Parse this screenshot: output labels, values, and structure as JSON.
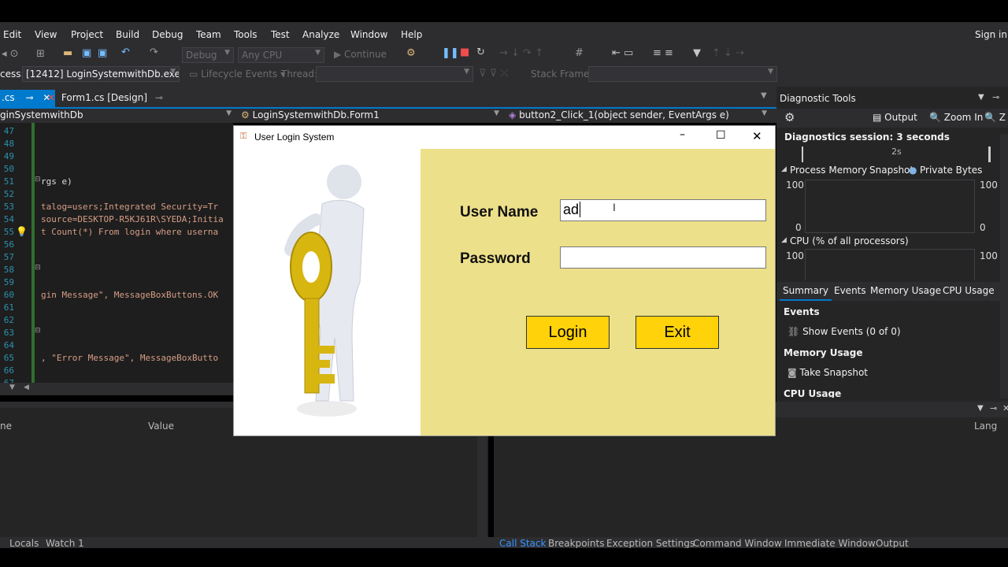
{
  "menu": {
    "items": [
      "Edit",
      "View",
      "Project",
      "Build",
      "Debug",
      "Team",
      "Tools",
      "Test",
      "Analyze",
      "Window",
      "Help"
    ],
    "sign_in": "Sign in"
  },
  "toolbar": {
    "config": "Debug",
    "platform": "Any CPU",
    "continue": "Continue",
    "process_label": "cess:",
    "process_value": "[12412] LoginSystemwithDb.exe",
    "lifecycle": "Lifecycle Events",
    "thread_label": "Thread:",
    "stack_label": "Stack Frame:"
  },
  "tabs": [
    {
      "label": ".cs",
      "pin": "⊸"
    },
    {
      "label": "Form1.cs [Design]",
      "pin": "⊸"
    }
  ],
  "nav": {
    "project": "ginSystemwithDb",
    "class": "LoginSystemwithDb.Form1",
    "method": "button2_Click_1(object sender, EventArgs e)"
  },
  "editor": {
    "lines": [
      "47",
      "48",
      "49",
      "50",
      "51",
      "52",
      "53",
      "54",
      "55",
      "56",
      "57",
      "58",
      "59",
      "60",
      "61",
      "62",
      "63",
      "64",
      "65",
      "66",
      "67"
    ],
    "code": [
      {
        "line": 4,
        "text": "rgs e)",
        "color": "#dcdcdc"
      },
      {
        "line": 6,
        "text": "talog=users;Integrated Security=Tr",
        "color": "#d69d85"
      },
      {
        "line": 7,
        "text": "source=DESKTOP-R5KJ61R\\SYEDA;Initia",
        "color": "#d69d85"
      },
      {
        "line": 8,
        "text": "t Count(*) From login where userna",
        "color": "#d69d85"
      },
      {
        "line": 13,
        "text": "gin Message\", MessageBoxButtons.OK",
        "color": "#d69d85"
      },
      {
        "line": 18,
        "text": ", \"Error Message\", MessageBoxButto",
        "color": "#d69d85"
      }
    ]
  },
  "login_window": {
    "title": "User Login System",
    "username_label": "User Name",
    "username_value": "ad",
    "password_label": "Password",
    "password_value": "",
    "login_button": "Login",
    "exit_button": "Exit"
  },
  "diagnostics": {
    "title": "Diagnostic Tools",
    "output": "Output",
    "zoom_in": "Zoom In",
    "zoom_out": "Z",
    "session": "Diagnostics session: 3 seconds",
    "timeline_tick": "2s",
    "process_memory": "Process Memory",
    "snapshot": "Snapshot",
    "private_bytes": "Private Bytes",
    "mem_max_left": "100",
    "mem_max_right": "100",
    "mem_min_left": "0",
    "mem_min_right": "0",
    "cpu_title": "CPU (% of all processors)",
    "cpu_max_left": "100",
    "cpu_max_right": "100",
    "tabs": [
      "Summary",
      "Events",
      "Memory Usage",
      "CPU Usage"
    ],
    "events_header": "Events",
    "show_events": "Show Events (0 of 0)",
    "memory_header": "Memory Usage",
    "take_snapshot": "Take Snapshot",
    "cpu_header": "CPU Usage"
  },
  "locals": {
    "col_name": "ne",
    "col_value": "Value",
    "col_lang": "Lang"
  },
  "status_tabs_left": [
    "Locals",
    "Watch 1"
  ],
  "status_tabs_right": [
    "Call Stack",
    "Breakpoints",
    "Exception Settings",
    "Command Window",
    "Immediate Window",
    "Output"
  ],
  "colors": {
    "accent": "#007acc",
    "login_panel": "#ede08a",
    "button_yellow": "#ffd20a"
  }
}
